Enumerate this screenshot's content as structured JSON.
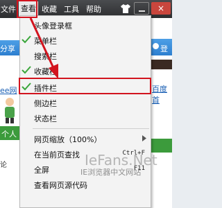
{
  "menubar": {
    "items": [
      "文件",
      "查看",
      "收藏",
      "工具",
      "帮助"
    ],
    "close_glyph": "×"
  },
  "background": {
    "left_snippet": "分享",
    "left_link": "ee网",
    "left_green": "个人",
    "left_bottom": "论",
    "right_login": "登录",
    "right_link": "百度首"
  },
  "view_menu": {
    "items": [
      {
        "label": "头像登录框",
        "checked": false
      },
      {
        "label": "菜单栏",
        "checked": true
      },
      {
        "label": "搜索栏",
        "checked": false
      },
      {
        "label": "收藏栏",
        "checked": true
      },
      {
        "label": "插件栏",
        "checked": true
      },
      {
        "label": "侧边栏",
        "checked": false
      },
      {
        "label": "状态栏",
        "checked": false
      },
      {
        "label": "网页缩放（100%）",
        "submenu": true
      },
      {
        "label": "在当前页查找",
        "shortcut": "Ctrl+F"
      },
      {
        "label": "全屏",
        "shortcut": "F11"
      },
      {
        "label": "查看网页源代码"
      }
    ]
  },
  "watermark": {
    "brand": "IeFans.Net",
    "subtitle": "IE浏览器中文网站"
  },
  "colors": {
    "highlight_red": "#d2141e",
    "check_green": "#3aa63a"
  }
}
